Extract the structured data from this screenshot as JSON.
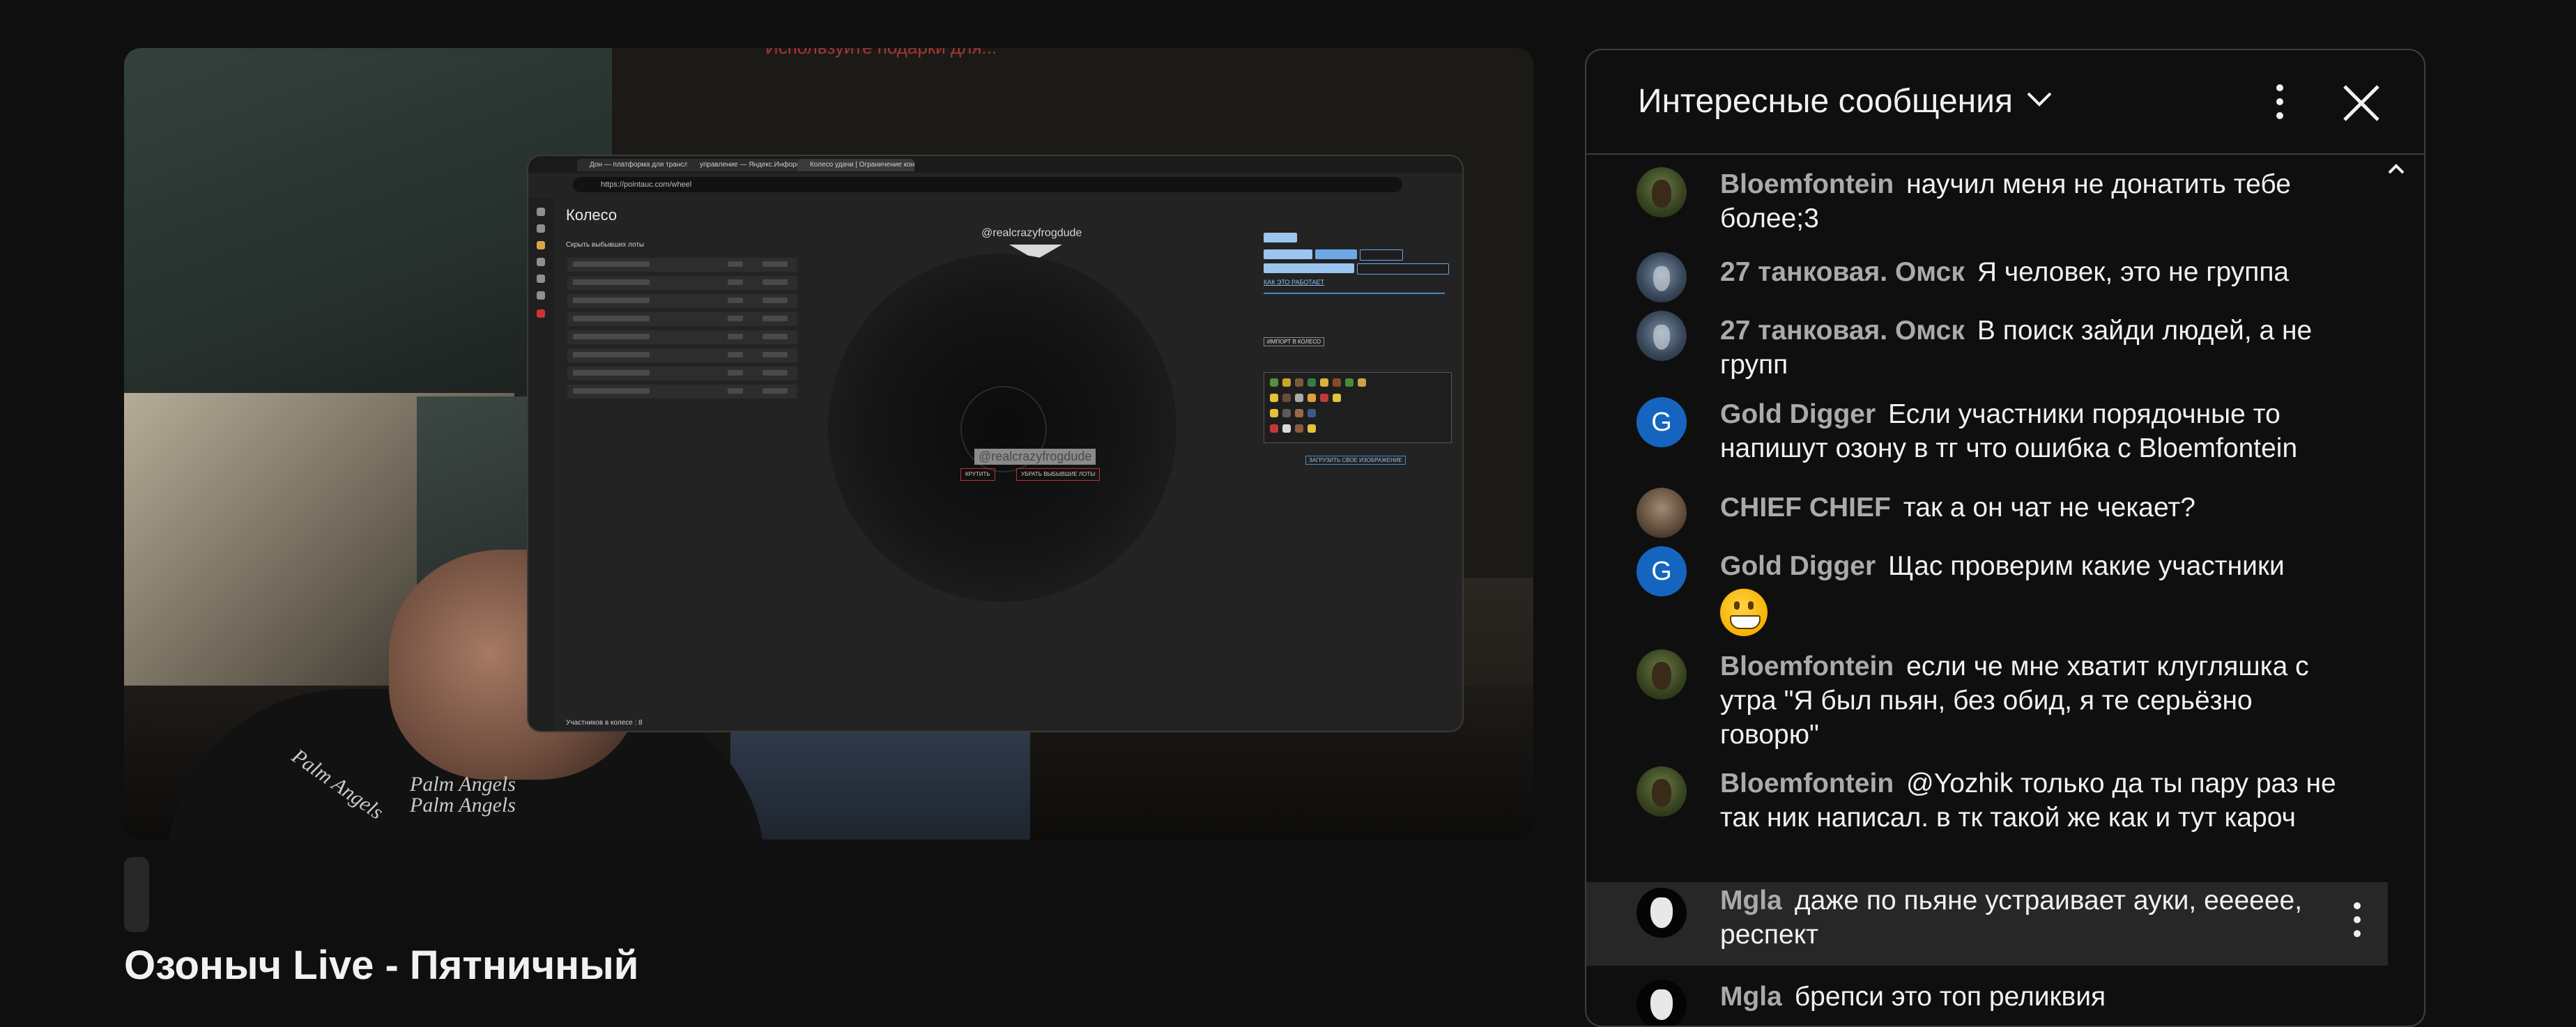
{
  "video": {
    "title": "Озоныч Live - Пятничный",
    "overlay_top_text": "Используйте подарки для...",
    "shirt_text": [
      "Palm Angels",
      "Palm Angels",
      "Palm Angels"
    ],
    "share_window": {
      "tabs": [
        "Дон — платформа для трансл...",
        "управление — Яндекс.Информ...",
        "Колесо удачи | Ограничение кон..."
      ],
      "url": "https://pointauc.com/wheel",
      "page_title": "Колесо",
      "hide_checkbox": "Скрыть выбывших лоты",
      "wheel_user": "@realcrazyfrogdude",
      "wheel_label": "@realcrazyfrogdude",
      "spin_button": "КРУТИТЬ",
      "remove_button": "УБРАТЬ ВЫБЫВШИЕ ЛОТЫ",
      "footer": "Участников в колесе : 8",
      "how_it_works": "КАК ЭТО РАБОТАЕТ",
      "import_button": "ИМПОРТ В КОЛЕСО",
      "load_button": "ЗАГРУЗИТЬ СВОЕ ИЗОБРАЖЕНИЕ"
    }
  },
  "chat": {
    "title": "Интересные сообщения",
    "icons": {
      "dropdown": "chevron-down-icon",
      "more": "more-vert-icon",
      "close": "close-icon",
      "scroll": "chevron-up-icon"
    },
    "messages": [
      {
        "author": "Bloemfontein",
        "text": "научил меня не донатить тебе более;3",
        "avatar": "frog"
      },
      {
        "author": "27 танковая. Омск",
        "text": "Я человек, это не группа",
        "avatar": "wolf"
      },
      {
        "author": "27 танковая. Омск",
        "text": "В поиск зайди людей, а не групп",
        "avatar": "wolf"
      },
      {
        "author": "Gold Digger",
        "text": "Если участники порядочные то напишут озону в тг что ошибка с Bloemfontein",
        "avatar": "G"
      },
      {
        "author": "CHIEF CHIEF",
        "text": "так а он чат не чекает?",
        "avatar": "chief"
      },
      {
        "author": "Gold Digger",
        "text": "Щас проверим какие участники",
        "avatar": "G",
        "emoji": "grinning-face"
      },
      {
        "author": "Bloemfontein",
        "text": "если че мне хватит клугляшка с утра \"Я был пьян, без обид, я те серьёзно говорю\"",
        "avatar": "frog"
      },
      {
        "author": "Bloemfontein",
        "text": "@Yozhik только да ты пару раз не так ник написал. в тк такой же как и тут кароч",
        "avatar": "frog"
      },
      {
        "author": "Mgla",
        "text": "даже по пьяне устраивает ауки, ееееее, респект",
        "avatar": "husky"
      },
      {
        "author": "Mgla",
        "text": "брепси это топ реликвия",
        "avatar": "husky"
      }
    ]
  }
}
